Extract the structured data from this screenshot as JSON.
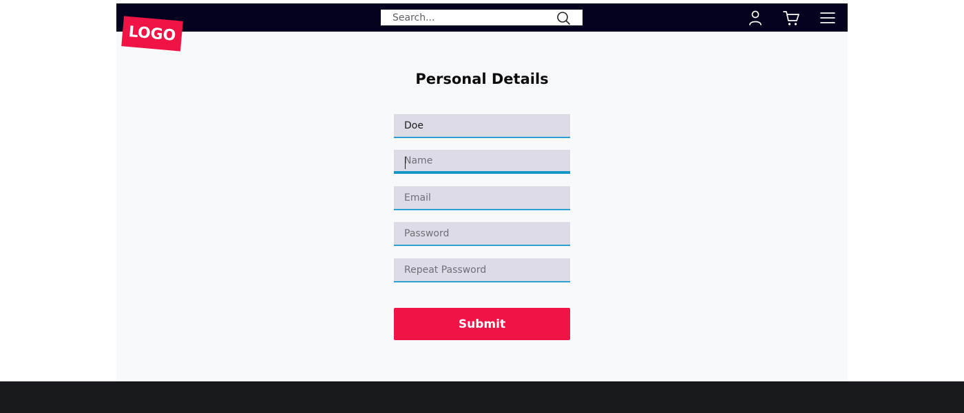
{
  "header": {
    "logo_text": "LOGO",
    "search": {
      "placeholder": "Search...",
      "value": ""
    },
    "icons": {
      "search": "search-icon",
      "account": "user-icon",
      "cart": "cart-icon",
      "menu": "hamburger-menu-icon"
    }
  },
  "form": {
    "title": "Personal Details",
    "fields": [
      {
        "name": "last-name",
        "value": "Doe",
        "placeholder": ""
      },
      {
        "name": "name",
        "value": "",
        "placeholder": "Name",
        "focused": true
      },
      {
        "name": "email",
        "value": "",
        "placeholder": "Email"
      },
      {
        "name": "password",
        "value": "",
        "placeholder": "Password"
      },
      {
        "name": "repeat-password",
        "value": "",
        "placeholder": "Repeat Password"
      }
    ],
    "submit_label": "Submit"
  },
  "colors": {
    "navbar": "#02021e",
    "accent": "#f01446",
    "field_background": "#dcdbe6",
    "field_underline": "#2a9fd0",
    "footer": "#18191d",
    "content_background": "#f8f9fb"
  }
}
